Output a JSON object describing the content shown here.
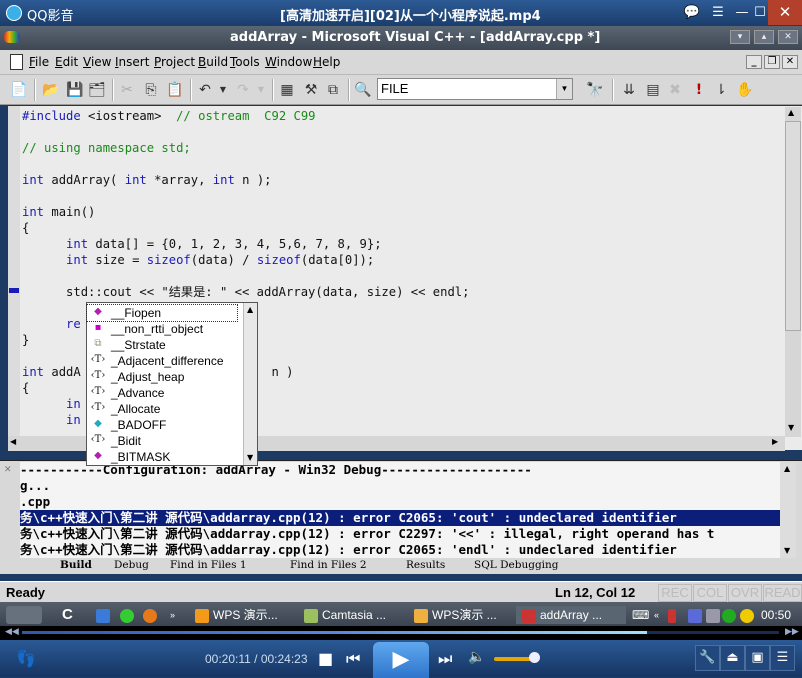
{
  "player": {
    "app_name": "QQ影音",
    "file_title": "[高清加速开启][02]从一个小程序说起.mp4",
    "time_current": "00:20:11",
    "time_total": "00:24:23",
    "time_display": "00:20:11 / 00:24:23",
    "progress_fraction": 0.825,
    "volume_fraction": 0.85,
    "title_buttons": [
      "chat-icon",
      "playlist-icon",
      "minimize",
      "maximize",
      "close"
    ],
    "controls": [
      "stop",
      "previous",
      "play",
      "next",
      "volume"
    ],
    "right_buttons": [
      "settings",
      "eject",
      "color",
      "list"
    ]
  },
  "vc": {
    "caption": "addArray - Microsoft Visual C++ - [addArray.cpp *]",
    "menu": [
      "File",
      "Edit",
      "View",
      "Insert",
      "Project",
      "Build",
      "Tools",
      "Window",
      "Help"
    ],
    "find_value": "FILE",
    "code_lines": [
      "#include <iostream>  // ostream  C92 C99",
      "",
      "// using namespace std;",
      "",
      "int addArray( int *array, int n );",
      "",
      "int main()",
      "{",
      "      int data[] = {0, 1, 2, 3, 4, 5,6, 7, 8, 9};",
      "      int size = sizeof(data) / sizeof(data[0]);",
      "",
      "      std::cout << \"结果是: \" << addArray(data, size) << endl;",
      "",
      "      re",
      "}",
      "",
      "int addA                          n )",
      "{",
      "      in",
      "      in"
    ],
    "autocomplete": [
      {
        "icon": "function-icon",
        "label": "__Fiopen"
      },
      {
        "icon": "class-icon",
        "label": "__non_rtti_object"
      },
      {
        "icon": "struct-icon",
        "label": "__Strstate"
      },
      {
        "icon": "template-icon",
        "label": "_Adjacent_difference"
      },
      {
        "icon": "template-icon",
        "label": "_Adjust_heap"
      },
      {
        "icon": "template-icon",
        "label": "_Advance"
      },
      {
        "icon": "template-icon",
        "label": "_Allocate"
      },
      {
        "icon": "constant-icon",
        "label": "_BADOFF"
      },
      {
        "icon": "template-icon",
        "label": "_Bidit"
      },
      {
        "icon": "function-icon",
        "label": "_BITMASK"
      }
    ],
    "output_lines": [
      {
        "text": "-----------Configuration: addArray - Win32 Debug--------------------",
        "selected": false
      },
      {
        "text": "g...",
        "selected": false
      },
      {
        "text": ".cpp",
        "selected": false
      },
      {
        "text": "务\\c++快速入门\\第二讲 源代码\\addarray.cpp(12) : error C2065: 'cout' : undeclared identifier",
        "selected": true
      },
      {
        "text": "务\\c++快速入门\\第二讲 源代码\\addarray.cpp(12) : error C2297: '<<' : illegal, right operand has t",
        "selected": false
      },
      {
        "text": "务\\c++快速入门\\第二讲 源代码\\addarray.cpp(12) : error C2065: 'endl' : undeclared identifier",
        "selected": false
      }
    ],
    "output_tabs": [
      "Build",
      "Debug",
      "Find in Files 1",
      "Find in Files 2",
      "Results",
      "SQL Debugging"
    ],
    "status_ready": "Ready",
    "status_position": "Ln 12, Col 12",
    "status_indicators": [
      "REC",
      "COL",
      "OVR",
      "READ"
    ]
  },
  "taskbar": {
    "items": [
      {
        "label": "WPS 演示...",
        "color": "#f39a1a"
      },
      {
        "label": "Camtasia ...",
        "color": "#9cc060"
      },
      {
        "label": "WPS演示 ...",
        "color": "#f0b040"
      },
      {
        "label": "addArray ...",
        "color": "#c33"
      }
    ],
    "clock": "00:50"
  }
}
